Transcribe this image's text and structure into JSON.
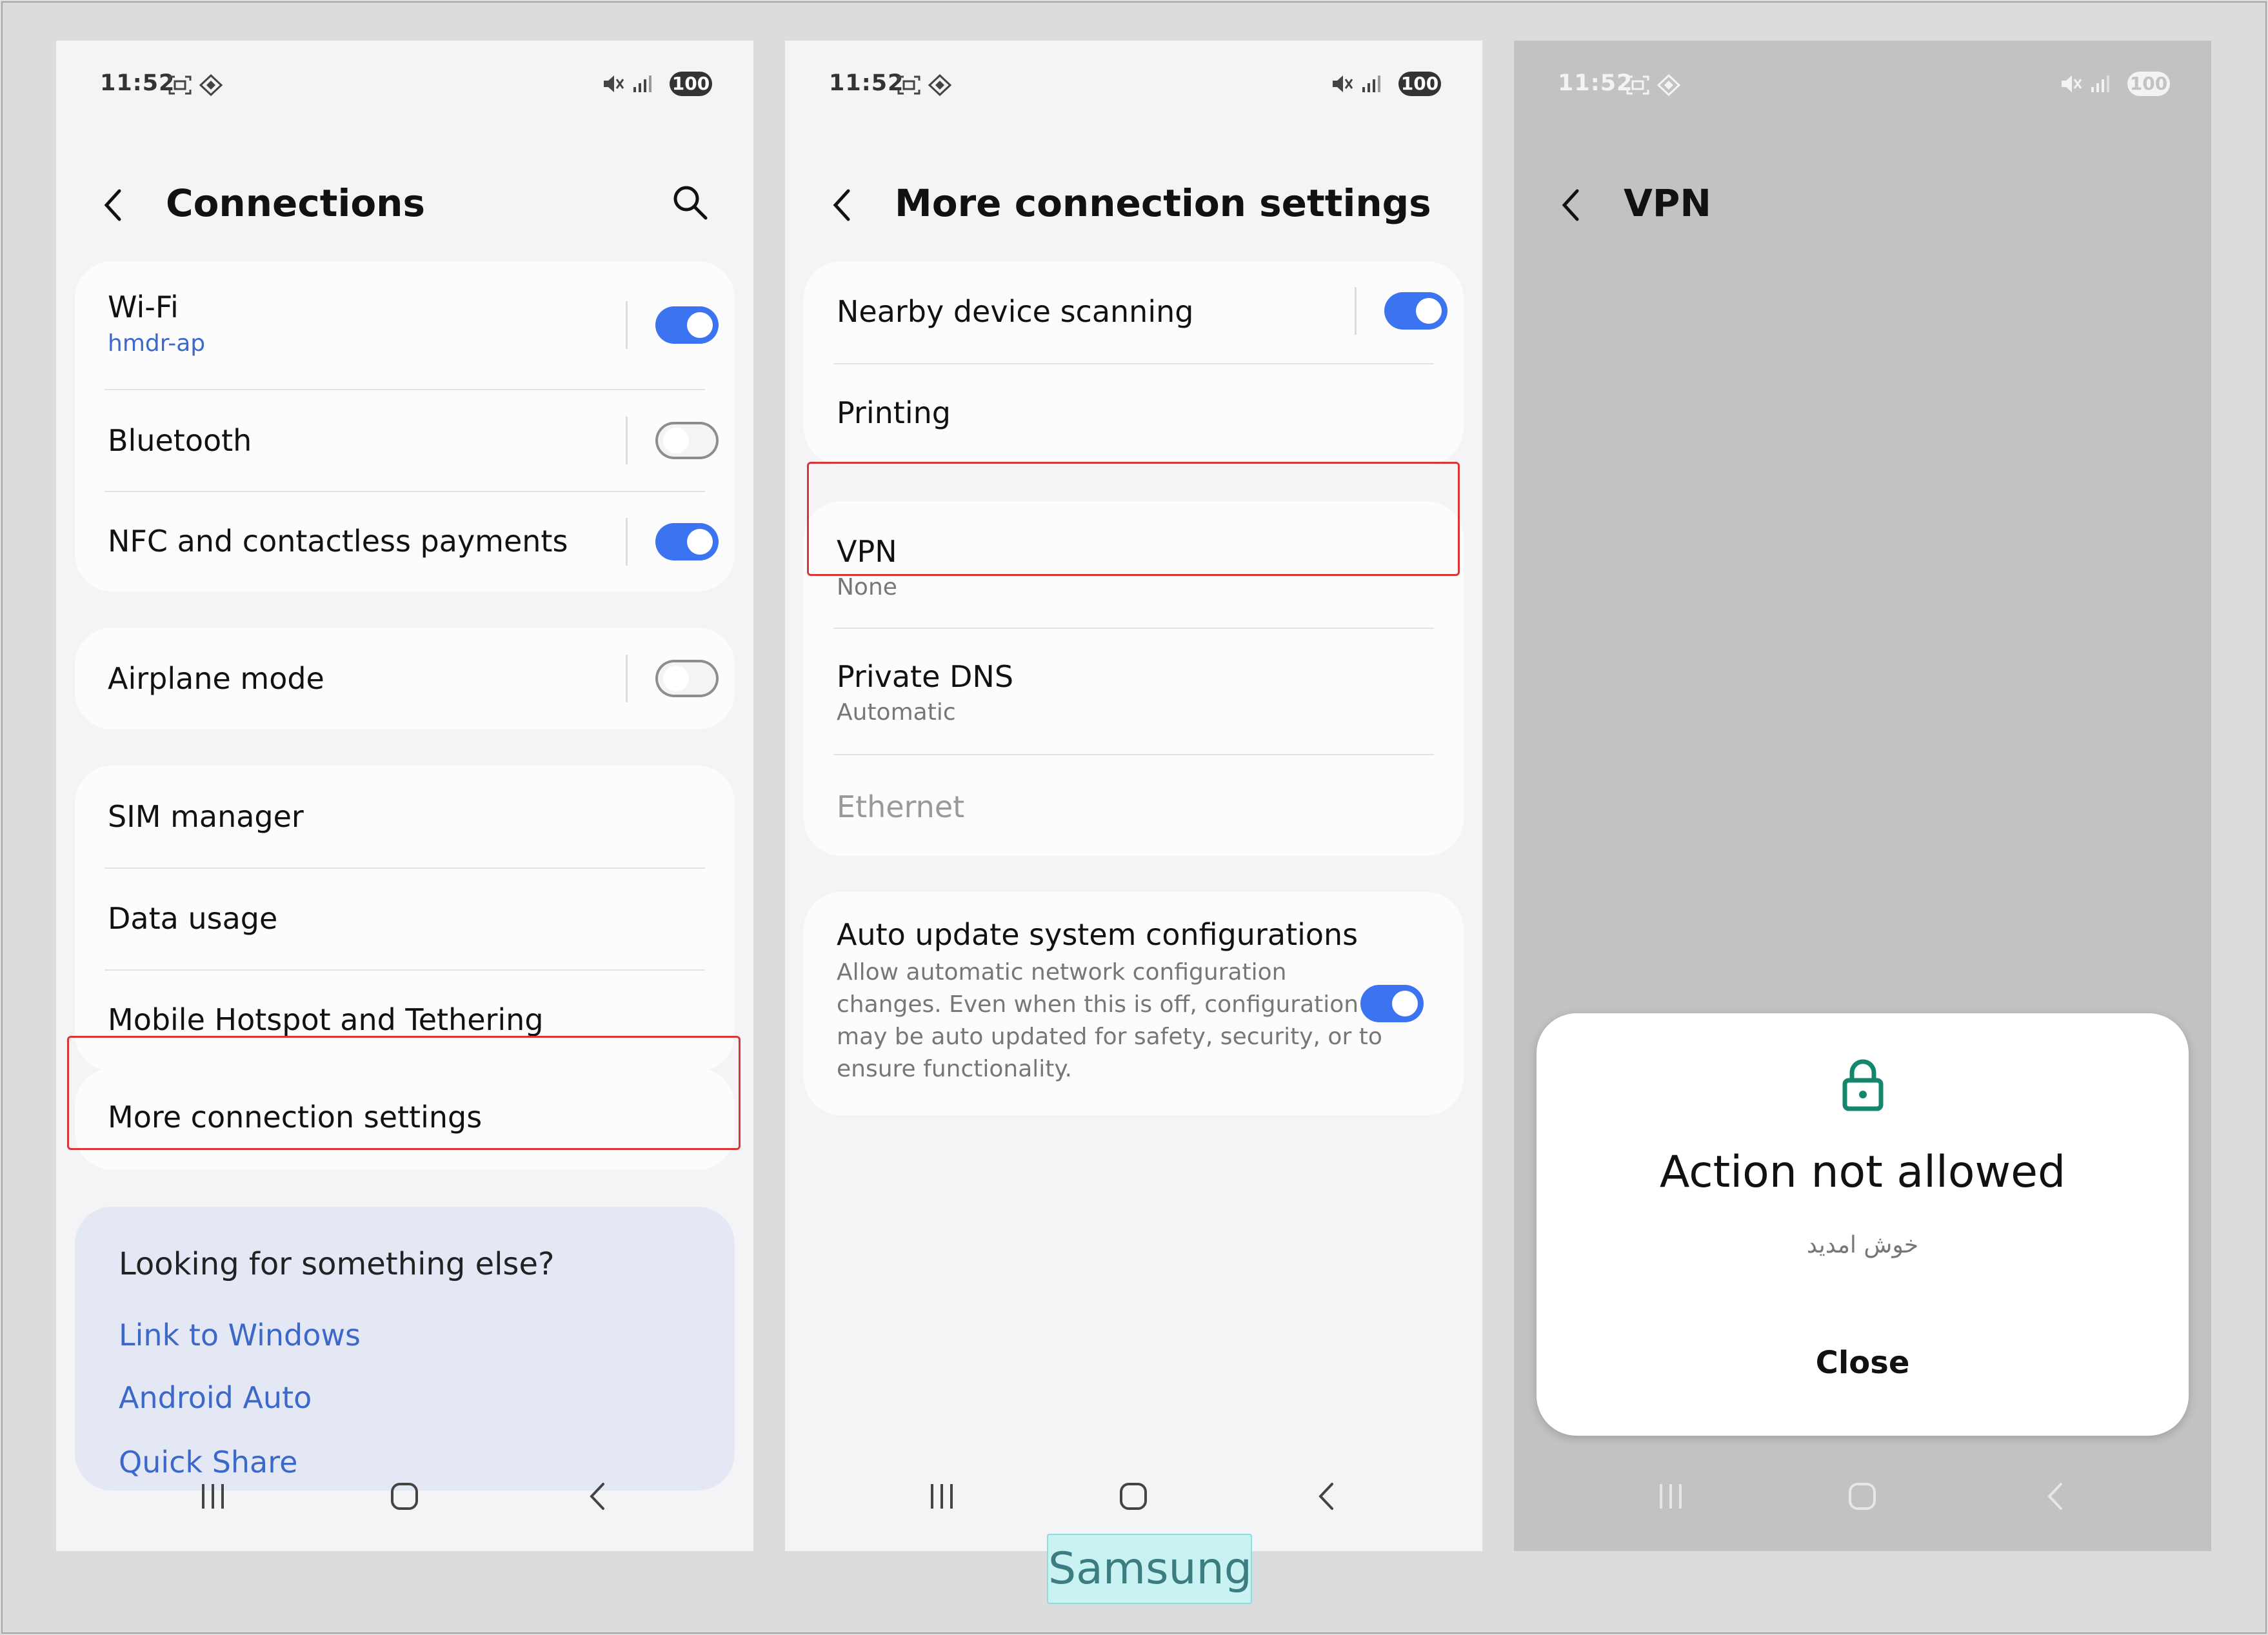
{
  "status_bar": {
    "time": "11:52",
    "battery": "100"
  },
  "screen1": {
    "title": "Connections",
    "wifi": {
      "label": "Wi-Fi",
      "network": "hmdr-ap",
      "enabled": true
    },
    "bluetooth": {
      "label": "Bluetooth",
      "enabled": false
    },
    "nfc": {
      "label": "NFC and contactless payments",
      "enabled": true
    },
    "airplane": {
      "label": "Airplane mode",
      "enabled": false
    },
    "sim_manager": "SIM manager",
    "data_usage": "Data usage",
    "hotspot": "Mobile Hotspot and Tethering",
    "more_connection": "More connection settings",
    "looking": {
      "title": "Looking for something else?",
      "links": [
        "Link to Windows",
        "Android Auto",
        "Quick Share"
      ]
    }
  },
  "screen2": {
    "title": "More connection settings",
    "nearby": {
      "label": "Nearby device scanning",
      "enabled": true
    },
    "printing": "Printing",
    "vpn": {
      "label": "VPN",
      "value": "None"
    },
    "private_dns": {
      "label": "Private DNS",
      "value": "Automatic"
    },
    "ethernet": "Ethernet",
    "auto_update": {
      "label": "Auto update system configurations",
      "line1": "Allow automatic network configuration",
      "line2": "changes. Even when this is off, configuration",
      "line3": "may be auto updated for safety, security, or to",
      "line4": "ensure functionality.",
      "enabled": true
    }
  },
  "screen3": {
    "title": "VPN",
    "dialog": {
      "title": "Action not allowed",
      "subtitle": "خوش امدید",
      "button": "Close"
    }
  },
  "caption": "Samsung",
  "colors": {
    "accent": "#3c73f0",
    "highlight": "#d93538",
    "link": "#3c69c9",
    "lock": "#14866d"
  }
}
